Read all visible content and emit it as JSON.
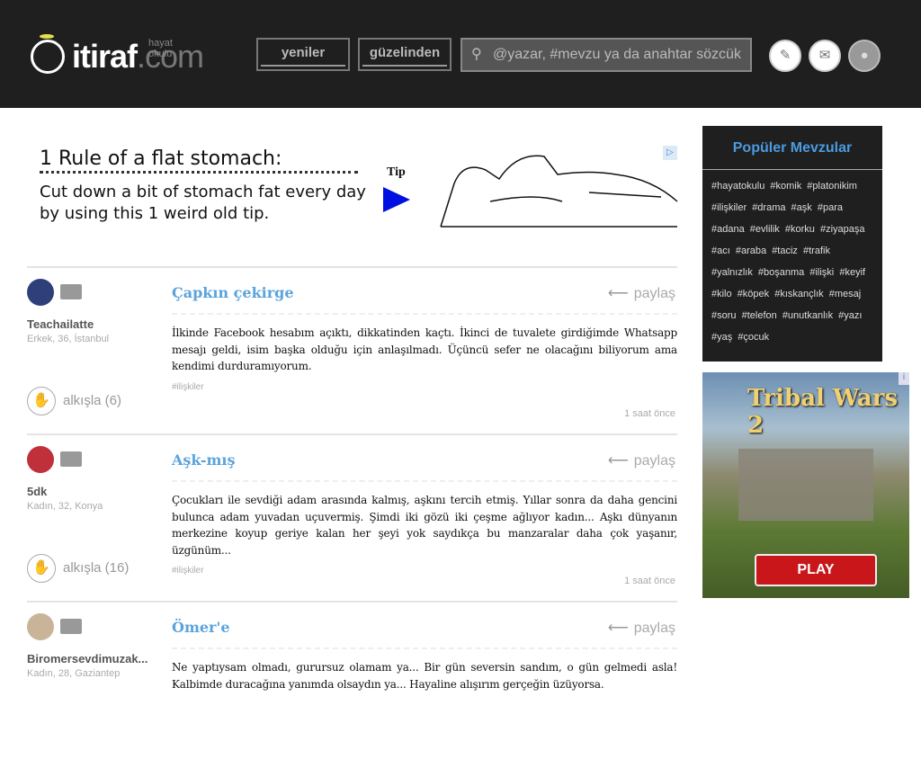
{
  "header": {
    "logo_name": "itiraf",
    "logo_com": ".com",
    "logo_sub": "hayat okulu",
    "nav": [
      {
        "label": "yeniler"
      },
      {
        "label": "güzelinden"
      }
    ],
    "search_placeholder": "@yazar, #mevzu ya da anahtar sözcük"
  },
  "ad": {
    "line1": "1 Rule of a flat stomach:",
    "line2": "Cut down a bit of stomach fat every day by using this 1 weird old tip.",
    "tip": "Tip"
  },
  "posts": [
    {
      "user": "Teachailatte",
      "info": "Erkek, 36, İstanbul",
      "clap": "alkışla (6)",
      "title": "Çapkın çekirge",
      "share": "paylaş",
      "body": "İlkinde Facebook hesabım açıktı, dikkatinden kaçtı. İkinci de tuvalete girdiğimde Whatsapp mesajı geldi, isim başka olduğu için anlaşılmadı. Üçüncü sefer ne olacağını biliyorum ama kendimi durduramıyorum.",
      "tag": "#ilişkiler",
      "time": "1 saat önce",
      "avatar_color": "#2f3f7a"
    },
    {
      "user": "5dk",
      "info": "Kadın, 32, Konya",
      "clap": "alkışla (16)",
      "title": "Aşk-mış",
      "share": "paylaş",
      "body": "Çocukları ile sevdiği adam arasında kalmış, aşkını tercih etmiş. Yıllar sonra da daha gencini bulunca adam yuvadan uçuvermiş. Şimdi iki gözü iki çeşme ağlıyor kadın... Aşkı dünyanın merkezine koyup geriye kalan her şeyi yok saydıkça bu manzaralar daha çok yaşanır, üzgünüm...",
      "tag": "#ilişkiler",
      "time": "1 saat önce",
      "avatar_color": "#c0303a"
    },
    {
      "user": "Biromersevdimuzak...",
      "info": "Kadın, 28, Gaziantep",
      "clap": "",
      "title": "Ömer'e",
      "share": "paylaş",
      "body": "Ne yaptıysam olmadı, gurursuz olamam ya... Bir gün seversin sandım, o gün gelmedi asla! Kalbimde duracağına yanımda olsaydın ya... Hayaline alışırım gerçeğin üzüyorsa.",
      "tag": "",
      "time": "",
      "avatar_color": "#c9b49a"
    }
  ],
  "sidebar": {
    "title": "Popüler Mevzular",
    "tags": [
      "#hayatokulu",
      "#komik",
      "#platonikim",
      "#ilişkiler",
      "#drama",
      "#aşk",
      "#para",
      "#adana",
      "#evlilik",
      "#korku",
      "#ziyapaşa",
      "#acı",
      "#araba",
      "#taciz",
      "#trafik",
      "#yalnızlık",
      "#boşanma",
      "#ilişki",
      "#keyif",
      "#kilo",
      "#köpek",
      "#kıskançlık",
      "#mesaj",
      "#soru",
      "#telefon",
      "#unutkanlık",
      "#yazı",
      "#yaş",
      "#çocuk"
    ]
  },
  "game_ad": {
    "title": "Tribal Wars 2",
    "play": "PLAY"
  }
}
